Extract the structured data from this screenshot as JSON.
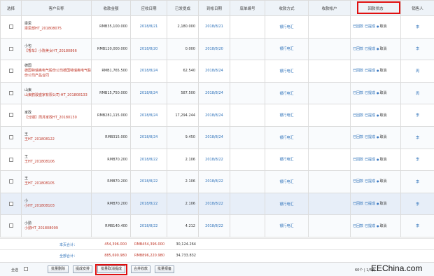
{
  "header": {
    "select": "选择",
    "customer": "客户名称",
    "amount": "收款金额",
    "due_date": "应收日期",
    "received": "已发提成",
    "arrival_date": "到帐日期",
    "receipt_no": "底单编号",
    "method": "收款方式",
    "account": "收款帐户",
    "status": "回款状态",
    "sales": "销售人"
  },
  "rows": [
    {
      "name": "梁思",
      "code": "梁思部HT_201808075",
      "amount": "RMB35,100.000",
      "due": "2018/8/21",
      "commission": "2,180.000",
      "arrival": "2018/8/21",
      "method": "银行电汇",
      "s1": "已回款",
      "s2": "已提成",
      "cancel": "取消",
      "sales": "李"
    },
    {
      "name": "小包",
      "code": "【香车】小陈美女HT_20180866",
      "amount": "RMB120,000.000",
      "due": "2018/8/20",
      "commission": "0.000",
      "arrival": "2018/8/20",
      "method": "银行电汇",
      "s1": "已回款",
      "s2": "已提成",
      "cancel": "取消",
      "sales": "李"
    },
    {
      "name": "德国",
      "code": "德国特瑞奥电气股份公司德国特瑞奥电气股份公司产品合同",
      "amount": "RMB1,765.500",
      "due": "2018/8/24",
      "commission": "62.540",
      "arrival": "2018/8/24",
      "method": "银行电汇",
      "s1": "已回款",
      "s2": "已提成",
      "cancel": "取消",
      "sales": "周"
    },
    {
      "name": "山東",
      "code": "山東鹤骏盛家有限公司-HT_201808133",
      "amount": "RMB15,750.000",
      "due": "2018/8/24",
      "commission": "587.500",
      "arrival": "2018/8/24",
      "method": "银行电汇",
      "s1": "已回款",
      "s2": "已提成",
      "cancel": "取消",
      "sales": "周"
    },
    {
      "name": "家政",
      "code": "【分期】周月家政HT_20180130",
      "amount": "RMB281,115.000",
      "due": "2018/8/24",
      "commission": "17,294.244",
      "arrival": "2018/8/24",
      "method": "银行电汇",
      "s1": "已回款",
      "s2": "已提成",
      "cancel": "取消",
      "sales": "李"
    },
    {
      "name": "王",
      "code": "王HT_201808122",
      "amount": "RMB315.000",
      "due": "2018/8/24",
      "commission": "9.450",
      "arrival": "2018/8/24",
      "method": "银行电汇",
      "s1": "已回款",
      "s2": "已提成",
      "cancel": "取消",
      "sales": "李"
    },
    {
      "name": "王",
      "code": "王HT_201808106",
      "amount": "RMB70.200",
      "due": "2018/8/22",
      "commission": "2.106",
      "arrival": "2018/8/22",
      "method": "银行电汇",
      "s1": "已回款",
      "s2": "已提成",
      "cancel": "取消",
      "sales": "李"
    },
    {
      "name": "王",
      "code": "王HT_201808105",
      "amount": "RMB70.200",
      "due": "2018/8/22",
      "commission": "2.106",
      "arrival": "2018/8/22",
      "method": "银行电汇",
      "s1": "已回款",
      "s2": "已提成",
      "cancel": "取消",
      "sales": "李"
    },
    {
      "name": "小",
      "code": "小HT_201808103",
      "amount": "RMB70.200",
      "due": "2018/8/22",
      "commission": "2.106",
      "arrival": "2018/8/22",
      "method": "银行电汇",
      "s1": "已回款",
      "s2": "已提成",
      "cancel": "取消",
      "sales": "李"
    },
    {
      "name": "小勤",
      "code": "小勤HT_201808099",
      "amount": "RMB140.400",
      "due": "2018/8/22",
      "commission": "4.212",
      "arrival": "2018/8/22",
      "method": "银行电汇",
      "s1": "已回款",
      "s2": "已提成",
      "cancel": "取消",
      "sales": "李"
    }
  ],
  "totals": {
    "page_label": "本页合计：",
    "page_amount": "454,396.000",
    "page_rmb": "RMB454,396.000",
    "page_commission": "30,124.264",
    "all_label": "全部合计：",
    "all_amount": "885,690.980",
    "all_rmb": "RMB896,220.980",
    "all_commission": "34,733.832"
  },
  "footer": {
    "select_all": "全选",
    "btn_delete": "批量删除",
    "btn_commission": "提成安排",
    "btn_cancel_commission": "批量取消提成",
    "btn_merge": "合并收款",
    "btn_report": "批量报备",
    "pager": "60个 | 1/5页",
    "watermark": "EEChina.com"
  }
}
